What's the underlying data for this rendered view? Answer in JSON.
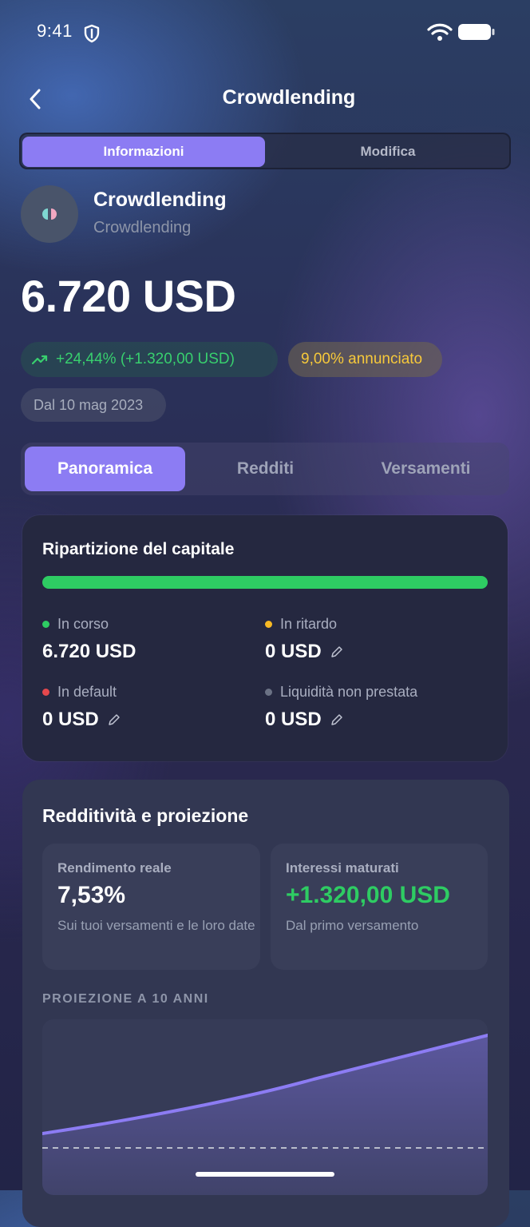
{
  "status_bar": {
    "time": "9:41"
  },
  "nav": {
    "title": "Crowdlending",
    "back_icon": "chevron-left-icon"
  },
  "top_segment": {
    "items": [
      "Informazioni",
      "Modifica"
    ],
    "selected": 0
  },
  "asset": {
    "name": "Crowdlending",
    "subtitle": "Crowdlending"
  },
  "value": {
    "amount": "6.720 USD"
  },
  "chips": {
    "gain": "+24,44% (+1.320,00 USD)",
    "announced": "9,00% annunciato",
    "since": "Dal 10 mag 2023"
  },
  "tabs": {
    "items": [
      "Panoramica",
      "Redditi",
      "Versamenti"
    ],
    "selected": 0
  },
  "capital": {
    "title": "Ripartizione del capitale",
    "in_progress_fraction": 1.0,
    "items": [
      {
        "label": "In corso",
        "value": "6.720 USD",
        "color": "#2ecc63"
      },
      {
        "label": "In ritardo",
        "value": "0 USD",
        "color": "#f7b924"
      },
      {
        "label": "In default",
        "value": "0 USD",
        "color": "#e5484d"
      },
      {
        "label": "Liquidità non prestata",
        "value": "0 USD",
        "color": "#6b7285"
      }
    ]
  },
  "yield": {
    "title": "Redditività e proiezione",
    "real_return": {
      "label": "Rendimento reale",
      "value": "7,53%",
      "sub": "Sui tuoi versamenti e le loro date"
    },
    "accrued": {
      "label": "Interessi maturati",
      "value": "+1.320,00 USD",
      "sub": "Dal primo versamento"
    },
    "projection_caption": "PROIEZIONE A 10 ANNI"
  },
  "colors": {
    "accent": "#8c7cf3",
    "positive": "#2ecc63",
    "warning": "#f7b924",
    "danger": "#e5484d"
  }
}
